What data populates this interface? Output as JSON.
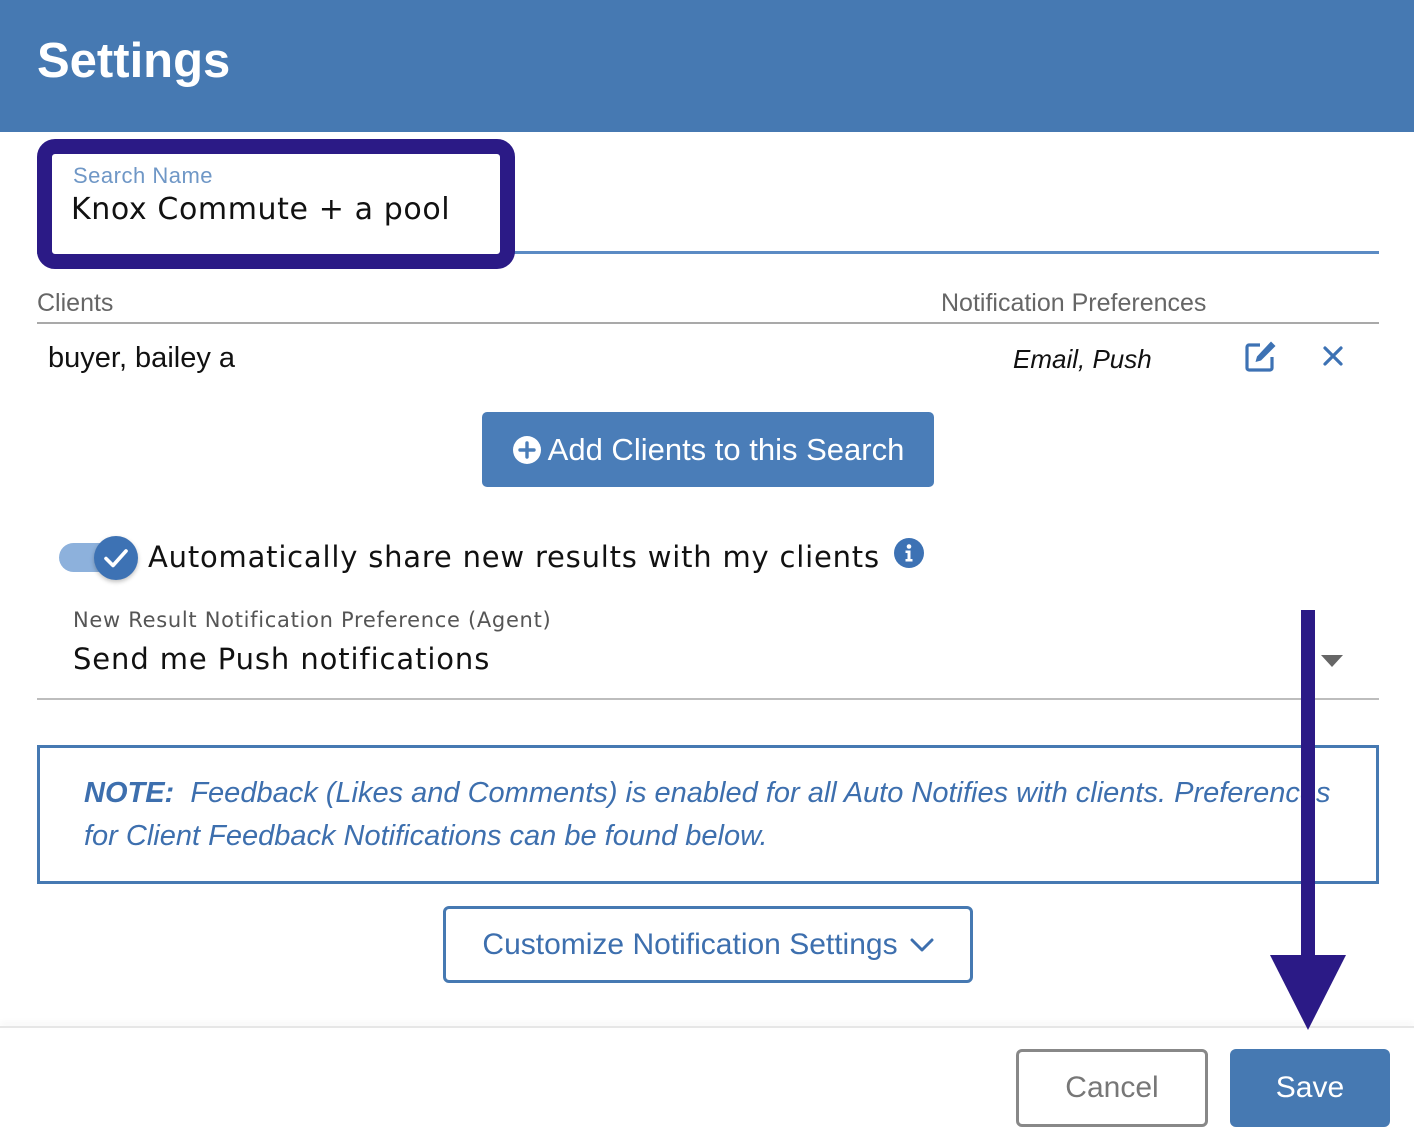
{
  "header": {
    "title": "Settings"
  },
  "search_name": {
    "label": "Search Name",
    "value": "Knox Commute + a pool"
  },
  "clients_table": {
    "headers": {
      "clients": "Clients",
      "notification_preferences": "Notification Preferences"
    },
    "rows": [
      {
        "name": "buyer, bailey a",
        "preferences": "Email, Push"
      }
    ]
  },
  "add_clients": {
    "label": "Add Clients to this Search"
  },
  "auto_share": {
    "label": "Automatically share new results with my clients",
    "enabled": true
  },
  "agent_notification": {
    "label": "New Result Notification Preference (Agent)",
    "value": "Send me Push notifications"
  },
  "note": {
    "prefix": "NOTE:",
    "text": "Feedback (Likes and Comments) is enabled for all Auto Notifies with clients. Preferences for Client Feedback Notifications can be found below."
  },
  "customize": {
    "label": "Customize Notification Settings"
  },
  "footer": {
    "cancel_label": "Cancel",
    "save_label": "Save"
  },
  "icons": {
    "edit": "edit-icon",
    "remove": "close-icon",
    "add": "plus-circle-icon",
    "toggle_check": "check-icon",
    "info": "info-icon",
    "select_caret": "caret-down-icon",
    "customize_chevron": "chevron-down-icon",
    "annotation": "arrow-down-icon"
  },
  "colors": {
    "brand_blue": "#4679b2",
    "highlight_outline": "#2b1a86",
    "note_text": "#3d6fae",
    "toggle_track": "#8db1dc"
  }
}
